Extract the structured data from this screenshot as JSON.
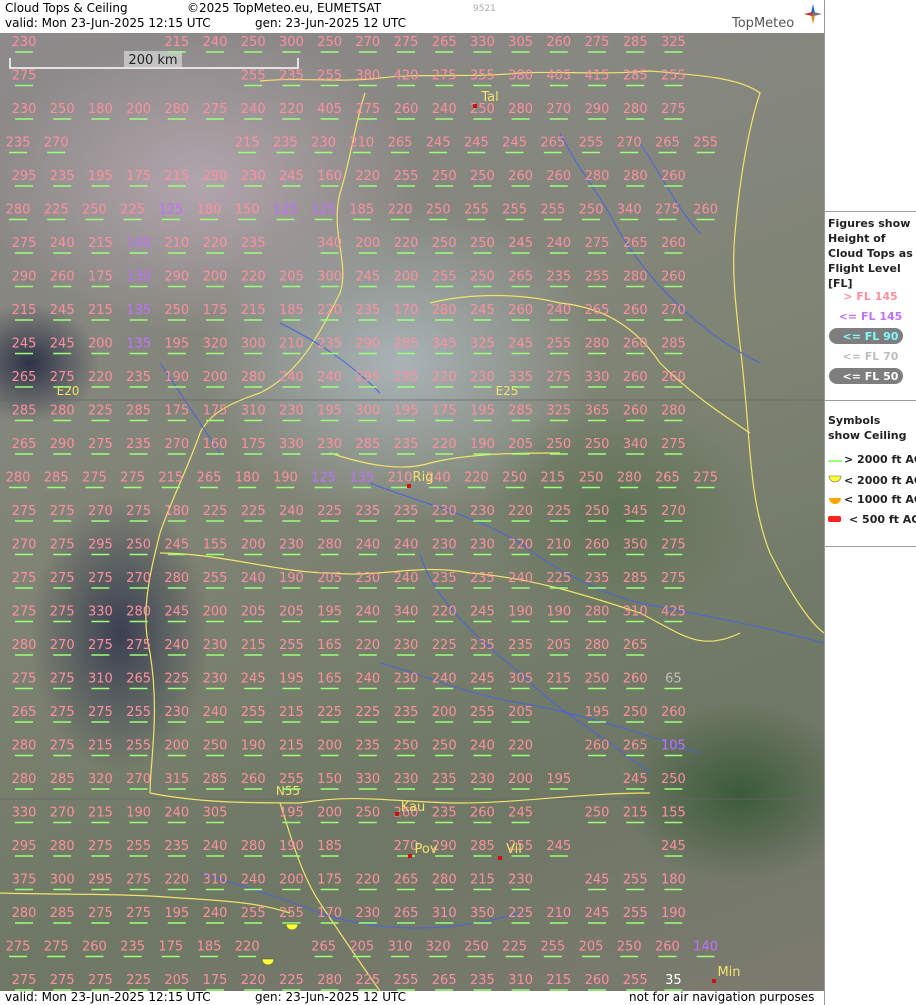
{
  "header": {
    "title": "Cloud Tops & Ceiling",
    "copyright": "©2025 TopMeteo.eu, EUMETSAT",
    "valid": "valid:  Mon  23-Jun-2025  12:15 UTC",
    "gen": "gen: 23-Jun-2025 12 UTC",
    "code": "9521",
    "logo": "TopMeteo"
  },
  "footer": {
    "valid": "valid:  Mon  23-Jun-2025  12:15 UTC",
    "gen": "gen: 23-Jun-2025 12 UTC",
    "disclaimer": "not for air navigation purposes"
  },
  "scale_label": "200 km",
  "cities": [
    {
      "name": "Tal"
    },
    {
      "name": "Rig"
    },
    {
      "name": "Kau"
    },
    {
      "name": "Pov"
    },
    {
      "name": "Vil"
    },
    {
      "name": "Min"
    }
  ],
  "grid_labels": [
    {
      "text": "E20"
    },
    {
      "text": "E25"
    },
    {
      "text": "N55"
    }
  ],
  "legend": {
    "tops_title": "Figures show Height of Cloud Tops as Flight Level [FL]",
    "tops": [
      {
        "label": "> FL 145",
        "color": "#ff8fa0"
      },
      {
        "label": "<= FL 145",
        "color": "#c070ff"
      },
      {
        "label": "<= FL 90",
        "color": "#7fffff"
      },
      {
        "label": "<= FL 70",
        "color": "#bdbdbd"
      },
      {
        "label": "<= FL 50",
        "color": "#ffffff"
      }
    ],
    "ceiling_title": "Symbols show Ceiling",
    "ceiling": [
      {
        "label": "> 2000 ft AGL",
        "color": "#9bff7a",
        "icon": "line"
      },
      {
        "label": "< 2000 ft AGL",
        "color": "#ffff33",
        "icon": "half-circle"
      },
      {
        "label": "< 1000 ft AGL",
        "color": "#ffa500",
        "icon": "half-circle"
      },
      {
        "label": "< 500 ft AGL",
        "color": "#ff2020",
        "icon": "dash"
      }
    ]
  },
  "cloud_tops_rows": [
    [
      "230",
      "",
      "",
      "",
      "215",
      "240",
      "250",
      "300",
      "250",
      "270",
      "275",
      "265",
      "330",
      "305",
      "260",
      "275",
      "285",
      "325"
    ],
    [
      "275",
      "",
      "",
      "",
      "",
      "",
      "255",
      "235",
      "255",
      "380",
      "420",
      "275",
      "355",
      "380",
      "405",
      "415",
      "285",
      "255"
    ],
    [
      "230",
      "250",
      "180",
      "200",
      "280",
      "275",
      "240",
      "220",
      "405",
      "275",
      "260",
      "240",
      "250",
      "280",
      "270",
      "290",
      "280",
      "275"
    ],
    [
      "235",
      "270",
      "",
      "",
      "",
      "",
      "215",
      "235",
      "230",
      "210",
      "265",
      "245",
      "245",
      "245",
      "265",
      "255",
      "270",
      "265",
      "255"
    ],
    [
      "295",
      "235",
      "195",
      "175",
      "215",
      "290",
      "230",
      "245",
      "160",
      "220",
      "255",
      "250",
      "250",
      "260",
      "260",
      "280",
      "280",
      "260"
    ],
    [
      "280",
      "225",
      "250",
      "225",
      "125",
      "180",
      "150",
      "125",
      "125",
      "185",
      "220",
      "250",
      "255",
      "255",
      "255",
      "250",
      "340",
      "275",
      "260"
    ],
    [
      "275",
      "240",
      "215",
      "140",
      "210",
      "220",
      "235",
      "",
      "340",
      "200",
      "220",
      "250",
      "250",
      "245",
      "240",
      "275",
      "265",
      "260"
    ],
    [
      "290",
      "260",
      "175",
      "130",
      "290",
      "200",
      "220",
      "205",
      "300",
      "245",
      "200",
      "255",
      "250",
      "265",
      "235",
      "255",
      "280",
      "260"
    ],
    [
      "215",
      "245",
      "215",
      "135",
      "250",
      "175",
      "215",
      "185",
      "220",
      "235",
      "170",
      "280",
      "245",
      "260",
      "240",
      "265",
      "260",
      "270"
    ],
    [
      "245",
      "245",
      "200",
      "135",
      "195",
      "320",
      "300",
      "210",
      "235",
      "290",
      "285",
      "345",
      "325",
      "245",
      "255",
      "280",
      "260",
      "285"
    ],
    [
      "265",
      "275",
      "220",
      "235",
      "190",
      "200",
      "280",
      "240",
      "240",
      "295",
      "195",
      "220",
      "230",
      "335",
      "275",
      "330",
      "260",
      "260"
    ],
    [
      "285",
      "280",
      "225",
      "285",
      "175",
      "175",
      "310",
      "230",
      "195",
      "300",
      "195",
      "175",
      "195",
      "285",
      "325",
      "365",
      "260",
      "280"
    ],
    [
      "265",
      "290",
      "275",
      "235",
      "270",
      "160",
      "175",
      "330",
      "230",
      "285",
      "235",
      "220",
      "190",
      "205",
      "250",
      "250",
      "340",
      "275"
    ],
    [
      "280",
      "285",
      "275",
      "275",
      "215",
      "265",
      "180",
      "190",
      "125",
      "135",
      "210",
      "240",
      "220",
      "250",
      "215",
      "250",
      "280",
      "265",
      "275"
    ],
    [
      "275",
      "275",
      "270",
      "275",
      "180",
      "225",
      "225",
      "240",
      "225",
      "235",
      "235",
      "230",
      "230",
      "220",
      "225",
      "250",
      "345",
      "270"
    ],
    [
      "270",
      "275",
      "295",
      "250",
      "245",
      "155",
      "200",
      "230",
      "280",
      "240",
      "240",
      "230",
      "230",
      "220",
      "210",
      "260",
      "350",
      "275"
    ],
    [
      "275",
      "275",
      "275",
      "270",
      "280",
      "255",
      "240",
      "190",
      "205",
      "230",
      "240",
      "235",
      "235",
      "240",
      "225",
      "235",
      "285",
      "275"
    ],
    [
      "275",
      "275",
      "330",
      "280",
      "245",
      "200",
      "205",
      "205",
      "195",
      "240",
      "340",
      "220",
      "245",
      "190",
      "190",
      "280",
      "310",
      "425"
    ],
    [
      "280",
      "270",
      "275",
      "275",
      "240",
      "230",
      "215",
      "255",
      "165",
      "220",
      "230",
      "225",
      "235",
      "235",
      "205",
      "280",
      "265"
    ],
    [
      "275",
      "275",
      "310",
      "265",
      "225",
      "230",
      "245",
      "195",
      "165",
      "240",
      "230",
      "240",
      "245",
      "305",
      "215",
      "250",
      "260",
      "65"
    ],
    [
      "265",
      "275",
      "275",
      "255",
      "230",
      "240",
      "255",
      "215",
      "225",
      "225",
      "235",
      "200",
      "255",
      "205",
      "",
      "195",
      "250",
      "260"
    ],
    [
      "280",
      "275",
      "215",
      "255",
      "200",
      "250",
      "190",
      "215",
      "200",
      "235",
      "250",
      "250",
      "240",
      "220",
      "",
      "260",
      "265",
      "105"
    ],
    [
      "280",
      "285",
      "320",
      "270",
      "315",
      "285",
      "260",
      "255",
      "150",
      "330",
      "230",
      "235",
      "230",
      "200",
      "195",
      "",
      "245",
      "250"
    ],
    [
      "330",
      "270",
      "215",
      "190",
      "240",
      "305",
      "",
      "195",
      "200",
      "250",
      "260",
      "235",
      "260",
      "245",
      "",
      "250",
      "215",
      "155"
    ],
    [
      "295",
      "280",
      "275",
      "255",
      "235",
      "240",
      "280",
      "190",
      "185",
      "",
      "270",
      "290",
      "285",
      "255",
      "245",
      "",
      "",
      "245"
    ],
    [
      "375",
      "300",
      "295",
      "275",
      "220",
      "310",
      "240",
      "200",
      "175",
      "220",
      "265",
      "280",
      "215",
      "230",
      "",
      "245",
      "255",
      "180"
    ],
    [
      "280",
      "285",
      "275",
      "275",
      "195",
      "240",
      "255",
      "255",
      "170",
      "230",
      "265",
      "310",
      "350",
      "225",
      "210",
      "245",
      "255",
      "190"
    ],
    [
      "275",
      "275",
      "260",
      "235",
      "175",
      "185",
      "220",
      "",
      "265",
      "205",
      "310",
      "320",
      "250",
      "225",
      "255",
      "205",
      "250",
      "260",
      "140"
    ],
    [
      "275",
      "275",
      "275",
      "225",
      "205",
      "175",
      "220",
      "225",
      "280",
      "225",
      "255",
      "265",
      "235",
      "310",
      "215",
      "260",
      "255",
      "35"
    ]
  ]
}
